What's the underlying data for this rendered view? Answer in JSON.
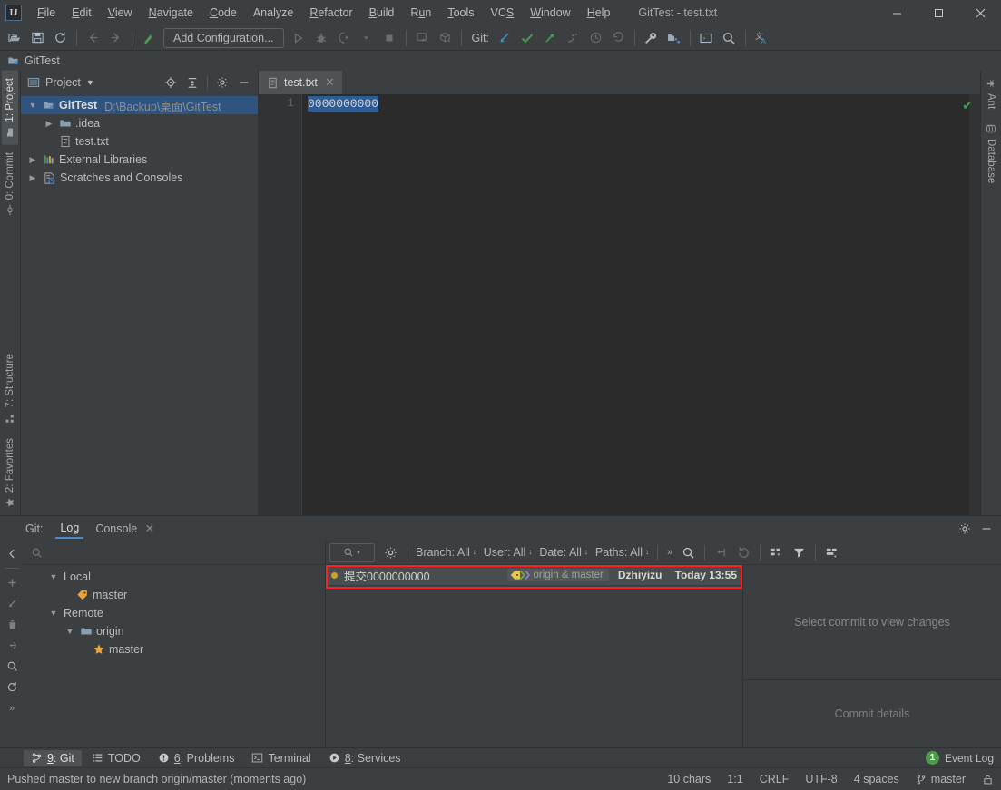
{
  "window": {
    "title": "GitTest - test.txt",
    "minimize": "—",
    "maximize": "□",
    "close": "✕"
  },
  "menu": [
    {
      "label": "File",
      "mnemonic": "F"
    },
    {
      "label": "Edit",
      "mnemonic": "E"
    },
    {
      "label": "View",
      "mnemonic": "V"
    },
    {
      "label": "Navigate",
      "mnemonic": "N"
    },
    {
      "label": "Code",
      "mnemonic": "C"
    },
    {
      "label": "Analyze",
      "mnemonic": ""
    },
    {
      "label": "Refactor",
      "mnemonic": "R"
    },
    {
      "label": "Build",
      "mnemonic": "B"
    },
    {
      "label": "Run",
      "mnemonic": "u"
    },
    {
      "label": "Tools",
      "mnemonic": "T"
    },
    {
      "label": "VCS",
      "mnemonic": "S"
    },
    {
      "label": "Window",
      "mnemonic": "W"
    },
    {
      "label": "Help",
      "mnemonic": "H"
    }
  ],
  "toolbar": {
    "add_configuration": "Add Configuration...",
    "git_label": "Git:",
    "icons": [
      "open-folder-icon",
      "save-all-icon",
      "sync-icon",
      "back-icon",
      "forward-icon",
      "build-icon"
    ],
    "run_icons": [
      "run-icon",
      "debug-icon",
      "run-with-coverage-icon",
      "profile-icon",
      "stop-icon"
    ],
    "extra_icons": [
      "update-project-icon",
      "commit-icon"
    ],
    "git_icons": [
      "update-project-icon",
      "commit-icon",
      "push-icon",
      "branch-icon",
      "history-icon",
      "rollback-icon"
    ],
    "right_icons": [
      "wrench-icon",
      "project-structure-icon",
      "terminal-icon",
      "search-everywhere-icon",
      "translate-icon"
    ]
  },
  "navbar": {
    "project_crumb": "GitTest"
  },
  "project_panel": {
    "title": "Project",
    "actions": [
      "locate-icon",
      "collapse-all-icon",
      "settings-icon",
      "hide-icon"
    ],
    "tree": [
      {
        "indent": 0,
        "arrow": "⌄",
        "icon": "module-icon",
        "label": "GitTest",
        "sub": "D:\\Backup\\桌面\\GitTest",
        "selected": true,
        "bold": true
      },
      {
        "indent": 1,
        "arrow": "›",
        "icon": "folder-icon",
        "label": ".idea",
        "sub": "",
        "selected": false,
        "bold": false
      },
      {
        "indent": 2,
        "arrow": "",
        "icon": "file-txt-icon",
        "label": "test.txt",
        "sub": "",
        "selected": false,
        "bold": false
      },
      {
        "indent": 0,
        "arrow": "›",
        "icon": "library-icon",
        "label": "External Libraries",
        "sub": "",
        "selected": false,
        "bold": false
      },
      {
        "indent": 0,
        "arrow": "›",
        "icon": "scratches-icon",
        "label": "Scratches and Consoles",
        "sub": "",
        "selected": false,
        "bold": false
      }
    ]
  },
  "left_stripe": [
    {
      "label": "1: Project",
      "icon": "project-icon",
      "active": true
    },
    {
      "label": "0: Commit",
      "icon": "commit-icon",
      "active": false
    }
  ],
  "left_stripe_bottom": [
    {
      "label": "7: Structure",
      "icon": "structure-icon"
    },
    {
      "label": "2: Favorites",
      "icon": "star-icon"
    }
  ],
  "right_stripe": [
    {
      "label": "Ant",
      "icon": "ant-icon"
    },
    {
      "label": "Database",
      "icon": "database-icon"
    }
  ],
  "editor": {
    "tab": {
      "label": "test.txt",
      "icon": "file-txt-icon",
      "close": "✕"
    },
    "line_numbers": [
      "1"
    ],
    "content": "0000000000",
    "selected": true,
    "inspection_status": "✔"
  },
  "git_window": {
    "label": "Git:",
    "tabs": [
      {
        "label": "Log",
        "active": true,
        "closable": false
      },
      {
        "label": "Console",
        "active": false,
        "closable": true,
        "close": "✕"
      }
    ],
    "head_actions": [
      "settings-icon",
      "hide-icon"
    ],
    "left_actions": [
      "collapse-panel-icon",
      "add-icon",
      "checkout-icon",
      "delete-icon",
      "merge-icon",
      "search-icon",
      "refresh-icon",
      "more-icon"
    ],
    "branch_search_placeholder": "",
    "branches": [
      {
        "indent": 0,
        "arrow": "⌄",
        "icon": "",
        "label": "Local"
      },
      {
        "indent": 1,
        "arrow": "",
        "icon": "tag-icon",
        "label": "master"
      },
      {
        "indent": 0,
        "arrow": "⌄",
        "icon": "",
        "label": "Remote"
      },
      {
        "indent": 1,
        "arrow": "⌄",
        "icon": "folder-icon",
        "label": "origin"
      },
      {
        "indent": 2,
        "arrow": "",
        "icon": "star-icon",
        "label": "master"
      }
    ],
    "log_toolbar": {
      "search_pill": "search-dropdown-icon",
      "settings_icon": "settings-icon",
      "filters": [
        {
          "label": "Branch: All"
        },
        {
          "label": "User: All"
        },
        {
          "label": "Date: All"
        },
        {
          "label": "Paths: All"
        }
      ],
      "overflow": "»",
      "icons": [
        "search-icon",
        "go-to-hash-icon",
        "refresh-icon",
        "show-graph-icon",
        "filter-icon",
        "columns-icon",
        "collapse-all-icon",
        "expand-all-icon"
      ]
    },
    "commits": [
      {
        "subject": "提交0000000000",
        "refs": "origin & master",
        "author": "Dzhiyizu",
        "date": "Today 13:55",
        "highlighted": true
      }
    ],
    "details": {
      "empty_changes": "Select commit to view changes",
      "footer": "Commit details"
    }
  },
  "bottom_tool_bar": {
    "items": [
      {
        "label": "9: Git",
        "mnemonic": "9",
        "icon": "git-icon",
        "active": true
      },
      {
        "label": "TODO",
        "mnemonic": "",
        "icon": "todo-icon",
        "active": false
      },
      {
        "label": "6: Problems",
        "mnemonic": "6",
        "icon": "problems-icon",
        "active": false
      },
      {
        "label": "Terminal",
        "mnemonic": "",
        "icon": "terminal-icon",
        "active": false
      },
      {
        "label": "8: Services",
        "mnemonic": "8",
        "icon": "services-icon",
        "active": false
      }
    ],
    "event_log": {
      "label": "Event Log",
      "count": "1"
    }
  },
  "status_bar": {
    "message": "Pushed master to new branch origin/master (moments ago)",
    "chars": "10 chars",
    "caret": "1:1",
    "line_sep": "CRLF",
    "encoding": "UTF-8",
    "indent": "4 spaces",
    "branch": "master",
    "branch_icon": "branch-icon",
    "lock_icon": "lock-icon"
  },
  "colors": {
    "accent_blue": "#4a88c7",
    "selection_blue": "#2f5480",
    "highlight_red": "#ff2020",
    "green_ok": "#499c54",
    "tag_yellow": "#c9a227"
  }
}
